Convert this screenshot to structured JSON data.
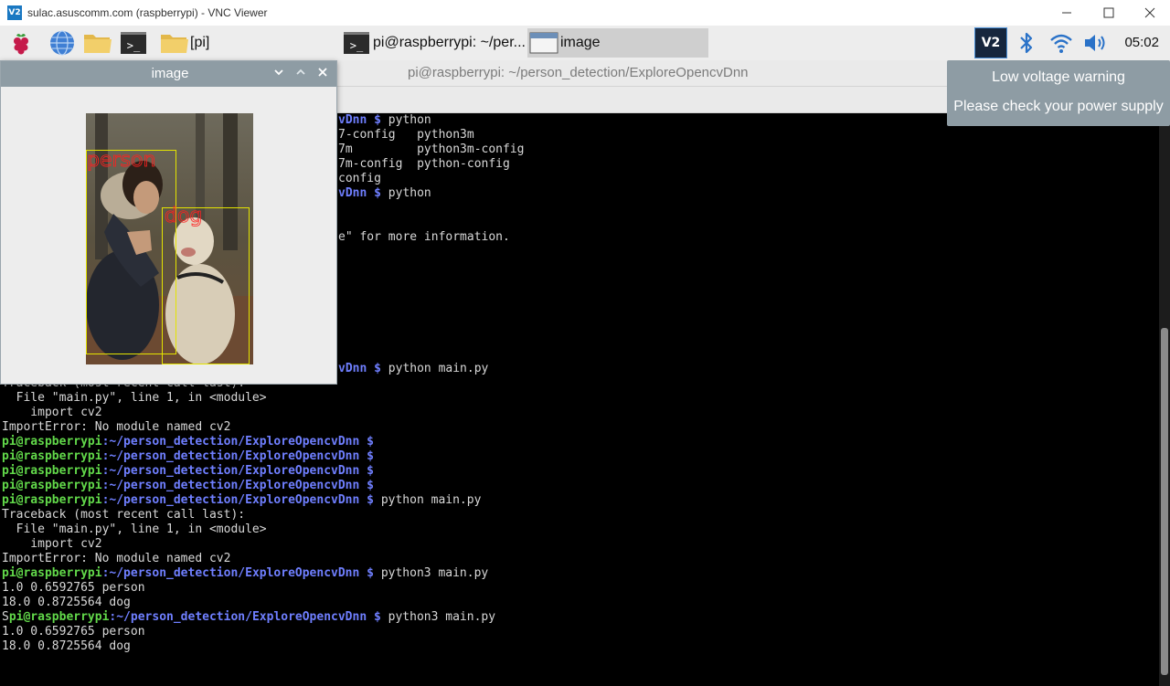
{
  "vnc": {
    "logo_text": "V2",
    "title": "sulac.asuscomm.com (raspberrypi) - VNC Viewer"
  },
  "taskbar": {
    "folder_button_label": "[pi]",
    "terminal_task_label": "pi@raspberrypi: ~/per...",
    "image_task_label": "image",
    "vnc_tray_label": "V2",
    "time": "05:02"
  },
  "terminal": {
    "title": "pi@raspberrypi: ~/person_detection/ExploreOpencvDnn",
    "prompt_user": "pi@raspberrypi",
    "prompt_path": "~/person_detection/ExploreOpencvDnn",
    "prompt_dollar": "$",
    "partial_lines": [
      "vDnn $ python",
      "7-config   python3m",
      "7m         python3m-config",
      "7m-config  python-config",
      "config",
      "vDnn $ python",
      "e\" for more information.",
      "vDnn $ python main.py"
    ],
    "traceback_first_line_partial": "Traceback (most recent call last):",
    "lines": [
      "  File \"main.py\", line 1, in <module>",
      "    import cv2",
      "ImportError: No module named cv2"
    ],
    "commands": {
      "run_python": "python main.py",
      "run_python3": "python3 main.py"
    },
    "traceback": [
      "Traceback (most recent call last):",
      "  File \"main.py\", line 1, in <module>",
      "    import cv2",
      "ImportError: No module named cv2"
    ],
    "output_1": [
      "1.0 0.6592765 person",
      "18.0 0.8725564 dog"
    ],
    "stray_char": "S",
    "output_2": [
      "1.0 0.6592765 person",
      "18.0 0.8725564 dog"
    ]
  },
  "image_window": {
    "title": "image",
    "label_person": "person",
    "label_dog": "dog",
    "box_color": "#e4e400",
    "label_color": "#ff2020"
  },
  "notification": {
    "title": "Low voltage warning",
    "message": "Please check your power supply"
  }
}
